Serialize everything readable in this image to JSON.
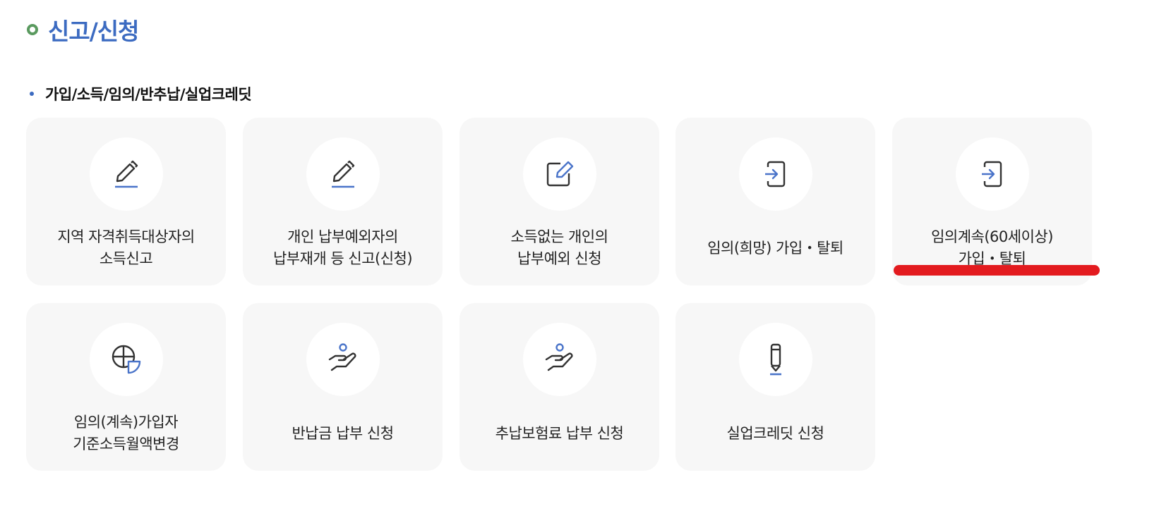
{
  "header": {
    "title": "신고/신청"
  },
  "section": {
    "title": "가입/소득/임의/반추납/실업크레딧"
  },
  "cards": [
    {
      "icon": "pencil-underline-icon",
      "line1": "지역 자격취득대상자의",
      "line2": "소득신고"
    },
    {
      "icon": "pencil-underline-icon",
      "line1": "개인 납부예외자의",
      "line2": "납부재개 등 신고(신청)"
    },
    {
      "icon": "edit-square-icon",
      "line1": "소득없는 개인의",
      "line2": "납부예외 신청"
    },
    {
      "icon": "login-arrow-icon",
      "line1": "임의(희망) 가입・탈퇴",
      "line2": ""
    },
    {
      "icon": "login-arrow-icon",
      "line1": "임의계속(60세이상)",
      "line2": "가입・탈퇴"
    },
    {
      "icon": "pie-chart-icon",
      "line1": "임의(계속)가입자",
      "line2": "기준소득월액변경"
    },
    {
      "icon": "hand-giving-icon",
      "line1": "반납금 납부 신청",
      "line2": ""
    },
    {
      "icon": "hand-giving-icon",
      "line1": "추납보험료 납부 신청",
      "line2": ""
    },
    {
      "icon": "pen-icon",
      "line1": "실업크레딧 신청",
      "line2": ""
    }
  ],
  "colors": {
    "title": "#3c6bc1",
    "icon_dark": "#333333",
    "icon_accent": "#4a74c9",
    "card_bg": "#f7f7f7",
    "annotation": "#e31b1f"
  }
}
